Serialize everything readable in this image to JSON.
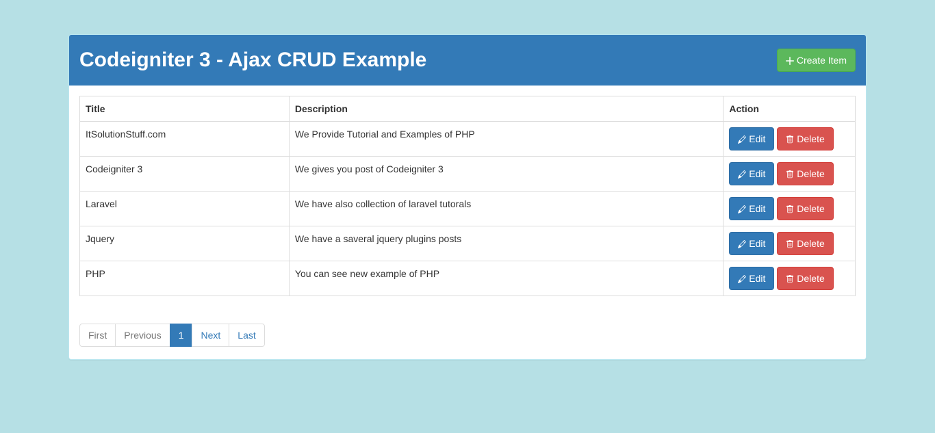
{
  "header": {
    "title": "Codeigniter 3 - Ajax CRUD Example",
    "create_label": "Create Item"
  },
  "table": {
    "columns": {
      "title": "Title",
      "description": "Description",
      "action": "Action"
    },
    "rows": [
      {
        "title": "ItSolutionStuff.com",
        "description": "We Provide Tutorial and Examples of PHP"
      },
      {
        "title": "Codeigniter 3",
        "description": "We gives you post of Codeigniter 3"
      },
      {
        "title": "Laravel",
        "description": "We have also collection of laravel tutorals"
      },
      {
        "title": "Jquery",
        "description": "We have a saveral jquery plugins posts"
      },
      {
        "title": "PHP",
        "description": "You can see new example of PHP"
      }
    ],
    "actions": {
      "edit": "Edit",
      "delete": "Delete"
    }
  },
  "pagination": {
    "first": "First",
    "previous": "Previous",
    "current": "1",
    "next": "Next",
    "last": "Last"
  }
}
